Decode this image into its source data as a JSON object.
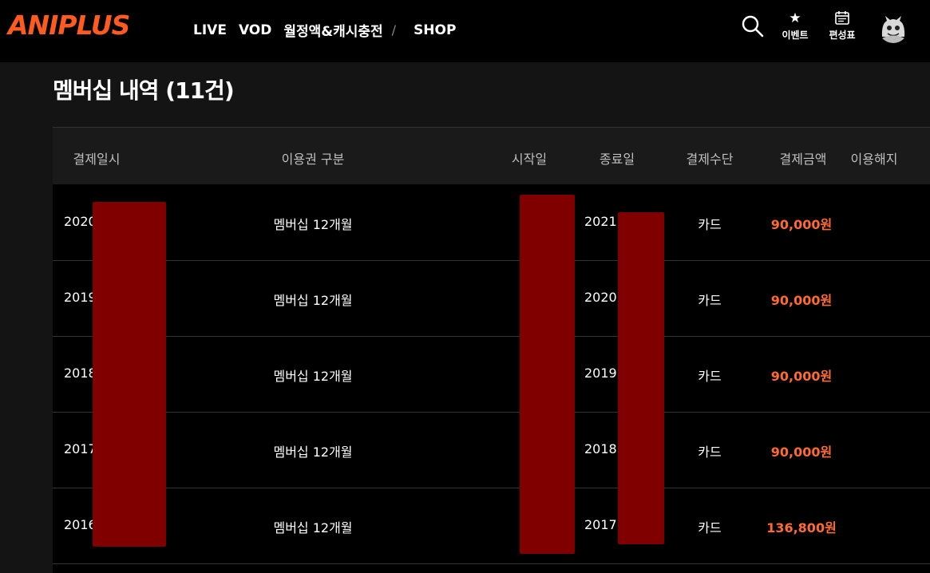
{
  "header": {
    "logo": "ANIPLUS",
    "nav": [
      "LIVE",
      "VOD",
      "월정액&캐시충전",
      "/",
      "SHOP"
    ],
    "icons": [
      {
        "name": "search-icon"
      },
      {
        "name": "star-icon",
        "label": "이벤트"
      },
      {
        "name": "calendar-icon",
        "label": "편성표"
      },
      {
        "name": "avatar"
      }
    ],
    "accent": "#ff5a1f"
  },
  "main": {
    "title": "멤버십 내역 (11건)",
    "columns": [
      "결제일시",
      "이용권 구분",
      "시작일",
      "종료일",
      "결제수단",
      "결제금액",
      "이용해지"
    ],
    "rows": [
      {
        "paid": "2020",
        "plan": "멤버십 12개월",
        "end": "2021.",
        "method": "카드",
        "amount": "90,000원"
      },
      {
        "paid": "2019",
        "plan": "멤버십 12개월",
        "end": "2020.",
        "method": "카드",
        "amount": "90,000원"
      },
      {
        "paid": "2018",
        "plan": "멤버십 12개월",
        "end": "2019.",
        "method": "카드",
        "amount": "90,000원"
      },
      {
        "paid": "2017",
        "plan": "멤버십 12개월",
        "end": "2018.",
        "method": "카드",
        "amount": "90,000원"
      },
      {
        "paid": "2016",
        "plan": "멤버십 12개월",
        "end": "2017.",
        "method": "카드",
        "amount": "136,800원"
      }
    ],
    "amount_color": "#ff6a33",
    "redaction_color": "#800000"
  }
}
